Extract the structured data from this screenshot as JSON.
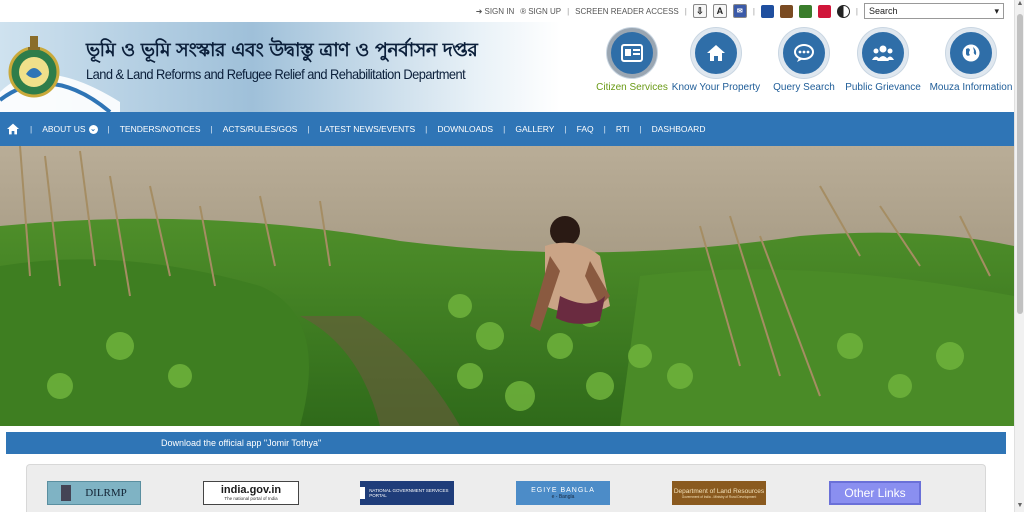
{
  "utility": {
    "sign_in": "SIGN IN",
    "sign_up": "SIGN UP",
    "screen_reader": "SCREEN READER ACCESS",
    "icons": [
      "download-icon",
      "font-size-icon",
      "accessibility-icon"
    ],
    "font_icon_text": "A",
    "color_swatches": [
      "#1f4f9f",
      "#7a4b22",
      "#3a7d2c",
      "#d0163a"
    ],
    "search_value": "Search"
  },
  "header": {
    "title_bengali": "ভূমি ও ভূমি সংস্কার এবং উদ্বাস্তু ত্রাণ ও পুনর্বাসন দপ্তর",
    "title_english": "Land & Land Reforms and Refugee Relief and Rehabilitation Department"
  },
  "quick_links": [
    {
      "label": "Citizen Services",
      "icon": "id-card-icon"
    },
    {
      "label": "Know Your Property",
      "icon": "home-icon"
    },
    {
      "label": "Query Search",
      "icon": "chat-bubble-icon"
    },
    {
      "label": "Public Grievance",
      "icon": "people-group-icon"
    },
    {
      "label": "Mouza Information",
      "icon": "globe-icon"
    }
  ],
  "nav": {
    "home_icon": "home-icon",
    "items": [
      "ABOUT US",
      "TENDERS/NOTICES",
      "ACTS/RULES/GOS",
      "LATEST NEWS/EVENTS",
      "DOWNLOADS",
      "GALLERY",
      "FAQ",
      "RTI",
      "DASHBOARD"
    ]
  },
  "hero": {
    "alt": "Woman tending plants in a green field"
  },
  "app_banner": "Download the official app \"Jomir Tothya\"",
  "partner_logos": [
    {
      "text": "DILRMP"
    },
    {
      "text": "india.gov.in",
      "sub": "The national portal of India"
    },
    {
      "text": "NATIONAL GOVERNMENT SERVICES PORTAL"
    },
    {
      "text": "EGIYE BANGLA",
      "sub": "e - Bangla"
    },
    {
      "text": "Department of Land Resources",
      "sub": "Government of India - Ministry of Rural Development"
    },
    {
      "text": "Other Links"
    }
  ],
  "colors": {
    "primary_blue": "#2f75b6",
    "active_green": "#6a9a16",
    "link_blue": "#1f5d98"
  }
}
